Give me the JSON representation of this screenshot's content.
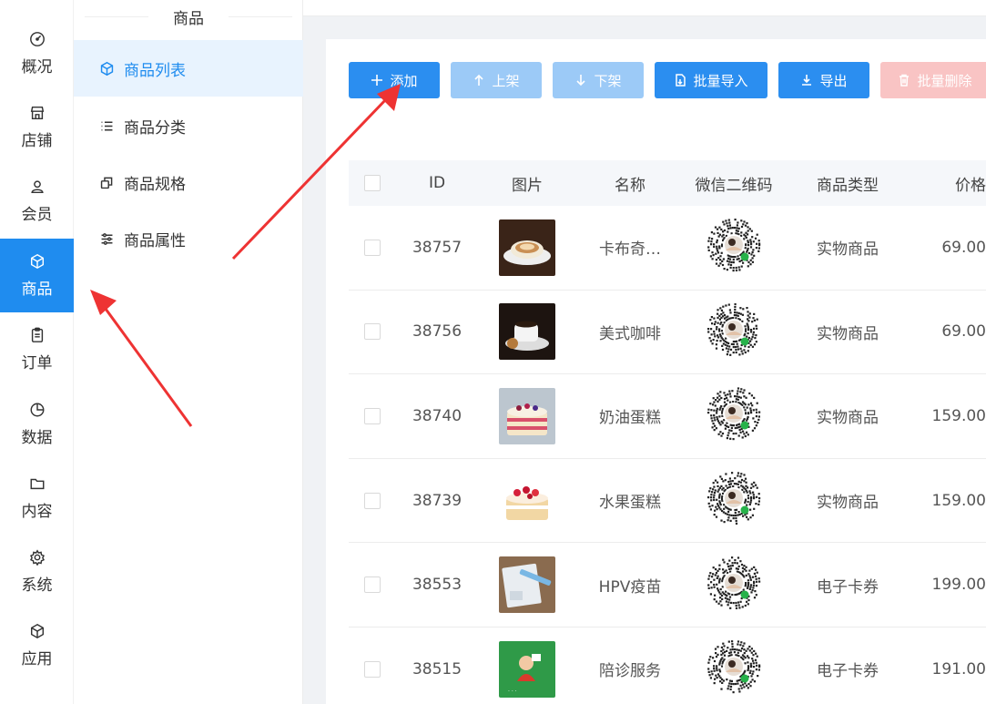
{
  "sidebar": {
    "items": [
      {
        "label": "概况",
        "icon": "dashboard-icon"
      },
      {
        "label": "店铺",
        "icon": "store-icon"
      },
      {
        "label": "会员",
        "icon": "user-icon"
      },
      {
        "label": "商品",
        "icon": "box-icon",
        "active": true
      },
      {
        "label": "订单",
        "icon": "clipboard-icon"
      },
      {
        "label": "数据",
        "icon": "pie-chart-icon"
      },
      {
        "label": "内容",
        "icon": "folder-icon"
      },
      {
        "label": "系统",
        "icon": "gear-icon"
      },
      {
        "label": "应用",
        "icon": "cube-icon"
      }
    ]
  },
  "subnav": {
    "title": "商品",
    "items": [
      {
        "label": "商品列表",
        "icon": "box-icon",
        "active": true
      },
      {
        "label": "商品分类",
        "icon": "list-icon"
      },
      {
        "label": "商品规格",
        "icon": "copy-icon"
      },
      {
        "label": "商品属性",
        "icon": "sliders-icon"
      }
    ]
  },
  "toolbar": {
    "add": "添加",
    "on_shelf": "上架",
    "off_shelf": "下架",
    "batch_import": "批量导入",
    "export": "导出",
    "batch_delete": "批量删除"
  },
  "table": {
    "headers": {
      "id": "ID",
      "image": "图片",
      "name": "名称",
      "qrcode": "微信二维码",
      "type": "商品类型",
      "price": "价格"
    },
    "rows": [
      {
        "id": "38757",
        "name": "卡布奇…",
        "type": "实物商品",
        "price": "69.00"
      },
      {
        "id": "38756",
        "name": "美式咖啡",
        "type": "实物商品",
        "price": "69.00"
      },
      {
        "id": "38740",
        "name": "奶油蛋糕",
        "type": "实物商品",
        "price": "159.00"
      },
      {
        "id": "38739",
        "name": "水果蛋糕",
        "type": "实物商品",
        "price": "159.00"
      },
      {
        "id": "38553",
        "name": "HPV疫苗",
        "type": "电子卡券",
        "price": "199.00"
      },
      {
        "id": "38515",
        "name": "陪诊服务",
        "type": "电子卡券",
        "price": "191.00"
      }
    ]
  },
  "colors": {
    "primary": "#1f8cef",
    "annotation": "#ee3333"
  }
}
